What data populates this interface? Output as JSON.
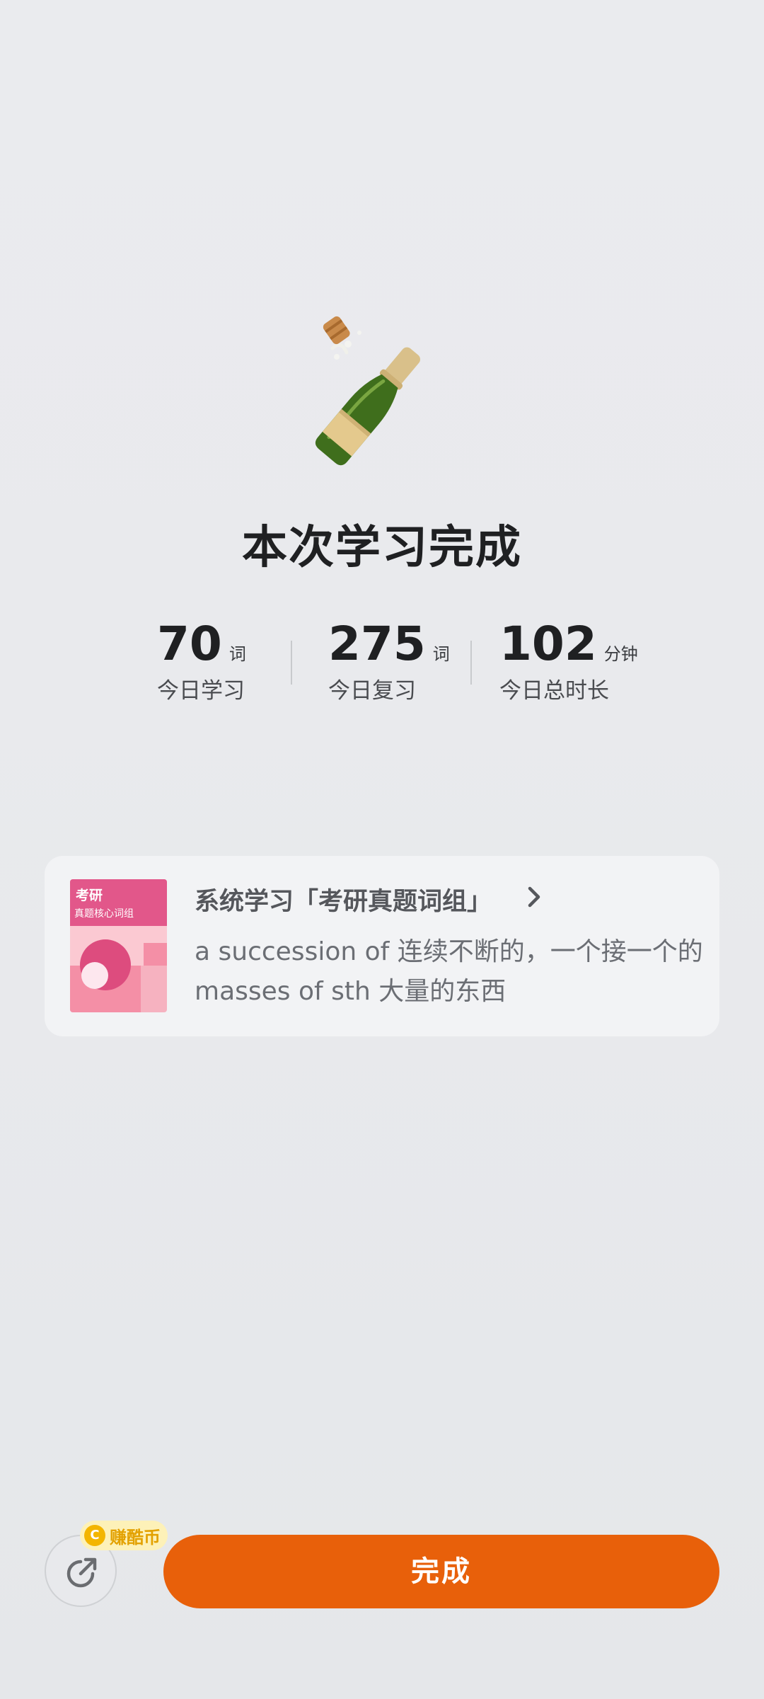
{
  "header": {
    "title": "本次学习完成",
    "icon": "champagne-bottle-icon"
  },
  "stats": [
    {
      "value": "70",
      "unit": "词",
      "label": "今日学习"
    },
    {
      "value": "275",
      "unit": "词",
      "label": "今日复习"
    },
    {
      "value": "102",
      "unit": "分钟",
      "label": "今日总时长"
    }
  ],
  "card": {
    "book_title_top": "考研",
    "book_title_sub": "真题核心词组",
    "title": "系统学习「考研真题词组」",
    "line1": "a succession of 连续不断的，一个接一个的",
    "line2": "masses of sth 大量的东西",
    "chevron": "chevron-right-icon"
  },
  "bottom": {
    "coin_icon_letter": "C",
    "coin_badge": "赚酷币",
    "share_icon": "share-icon",
    "done_label": "完成"
  },
  "colors": {
    "accent": "#e8600a",
    "coin": "#f3b500"
  }
}
